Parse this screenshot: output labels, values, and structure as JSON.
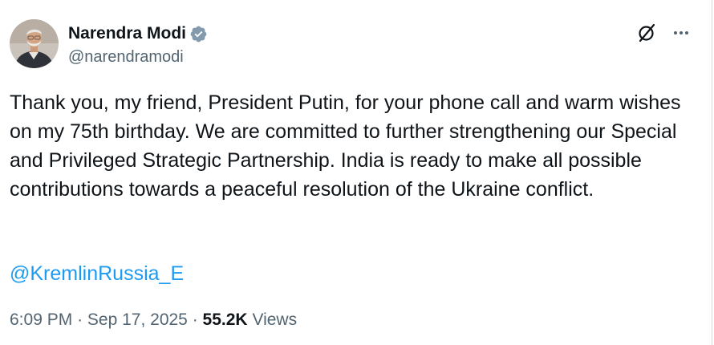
{
  "author": {
    "display_name": "Narendra Modi",
    "handle": "@narendramodi",
    "verified": true,
    "verified_badge_color": "#829aab"
  },
  "icons": {
    "grok": "grok-slash-circle-icon",
    "more": "more-options-ellipsis-icon",
    "verified": "verified-badge-icon"
  },
  "tweet": {
    "text": "Thank you, my friend, President Putin, for your phone call and warm wishes on my 75th birthday. We are committed to further strengthening our Special and Privileged Strategic Partnership. India is ready to make all possible contributions towards a peaceful resolution of the Ukraine conflict.",
    "mention": "@KremlinRussia_E",
    "time": "6:09 PM",
    "separator": "·",
    "date": "Sep 17, 2025",
    "views_count": "55.2K",
    "views_label": "Views"
  },
  "colors": {
    "text_primary": "#0f1419",
    "text_secondary": "#536471",
    "link": "#1d9bf0"
  }
}
